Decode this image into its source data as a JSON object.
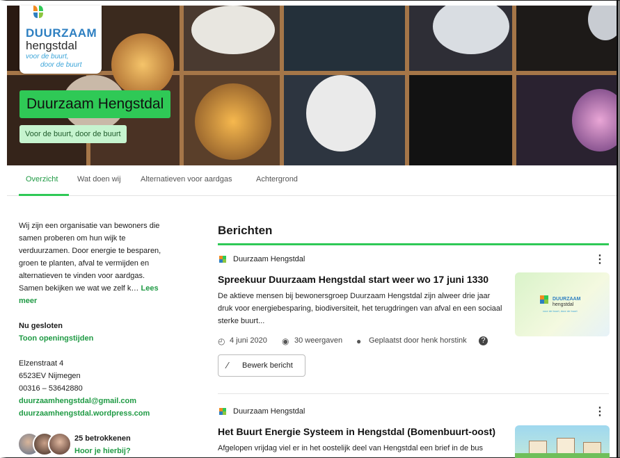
{
  "banner": {
    "logo": {
      "line1": "DUURZAAM",
      "line2": "hengstdal",
      "line3": "voor de buurt,",
      "line4": "door de buurt"
    },
    "title": "Duurzaam Hengstdal",
    "tagline": "Voor de buurt, door de buurt"
  },
  "tabs": [
    {
      "label": "Overzicht",
      "active": true
    },
    {
      "label": "Wat doen wij",
      "active": false
    },
    {
      "label": "Alternatieven voor aardgas",
      "active": false
    },
    {
      "label": "Achtergrond",
      "active": false
    }
  ],
  "sidebar": {
    "about": "Wij zijn een organisatie van bewoners die samen proberen om hun wijk te verduurzamen. Door energie te besparen, groen te planten, afval te vermijden en alternatieven te vinden voor aardgas. Samen bekijken we wat we zelf k…",
    "read_more": "Lees meer",
    "status": "Nu gesloten",
    "hours_link": "Toon openingstijden",
    "address_line1": "Elzenstraat 4",
    "address_line2": "6523EV Nijmegen",
    "phone": "00316 – 53642880",
    "email": "duurzaamhengstdal@gmail.com",
    "website": "duurzaamhengstdal.wordpress.com",
    "members_count": "25 betrokkenen",
    "members_cta": "Hoor je hierbij?"
  },
  "feed": {
    "title": "Berichten",
    "posts": [
      {
        "author": "Duurzaam Hengstdal",
        "title": "Spreekuur Duurzaam Hengstdal start weer wo 17 juni 1330",
        "body": "De aktieve mensen bij bewonersgroep Duurzaam Hengstdal zijn alweer drie jaar druk voor energiebesparing, biodiversiteit, het terugdringen van afval en een sociaal sterke buurt...",
        "date": "4 juni 2020",
        "views": "30 weergaven",
        "posted_by": "Geplaatst door henk horstink",
        "edit_label": "Bewerk bericht",
        "thumb_text1": "DUURZAAM",
        "thumb_text2": "hengstdal",
        "thumb_text3": "voor de buurt, door de buurt"
      },
      {
        "author": "Duurzaam Hengstdal",
        "title": "Het Buurt Energie Systeem in Hengstdal (Bomenbuurt-oost)",
        "body": "Afgelopen vrijdag viel er in het oostelijk deel van Hengstdal een brief in de bus"
      }
    ]
  },
  "colors": {
    "accent_green": "#2fc956",
    "link_green": "#1f9a44",
    "tagline_bg": "#c6f4cf",
    "logo_blue": "#2d7fc1"
  }
}
